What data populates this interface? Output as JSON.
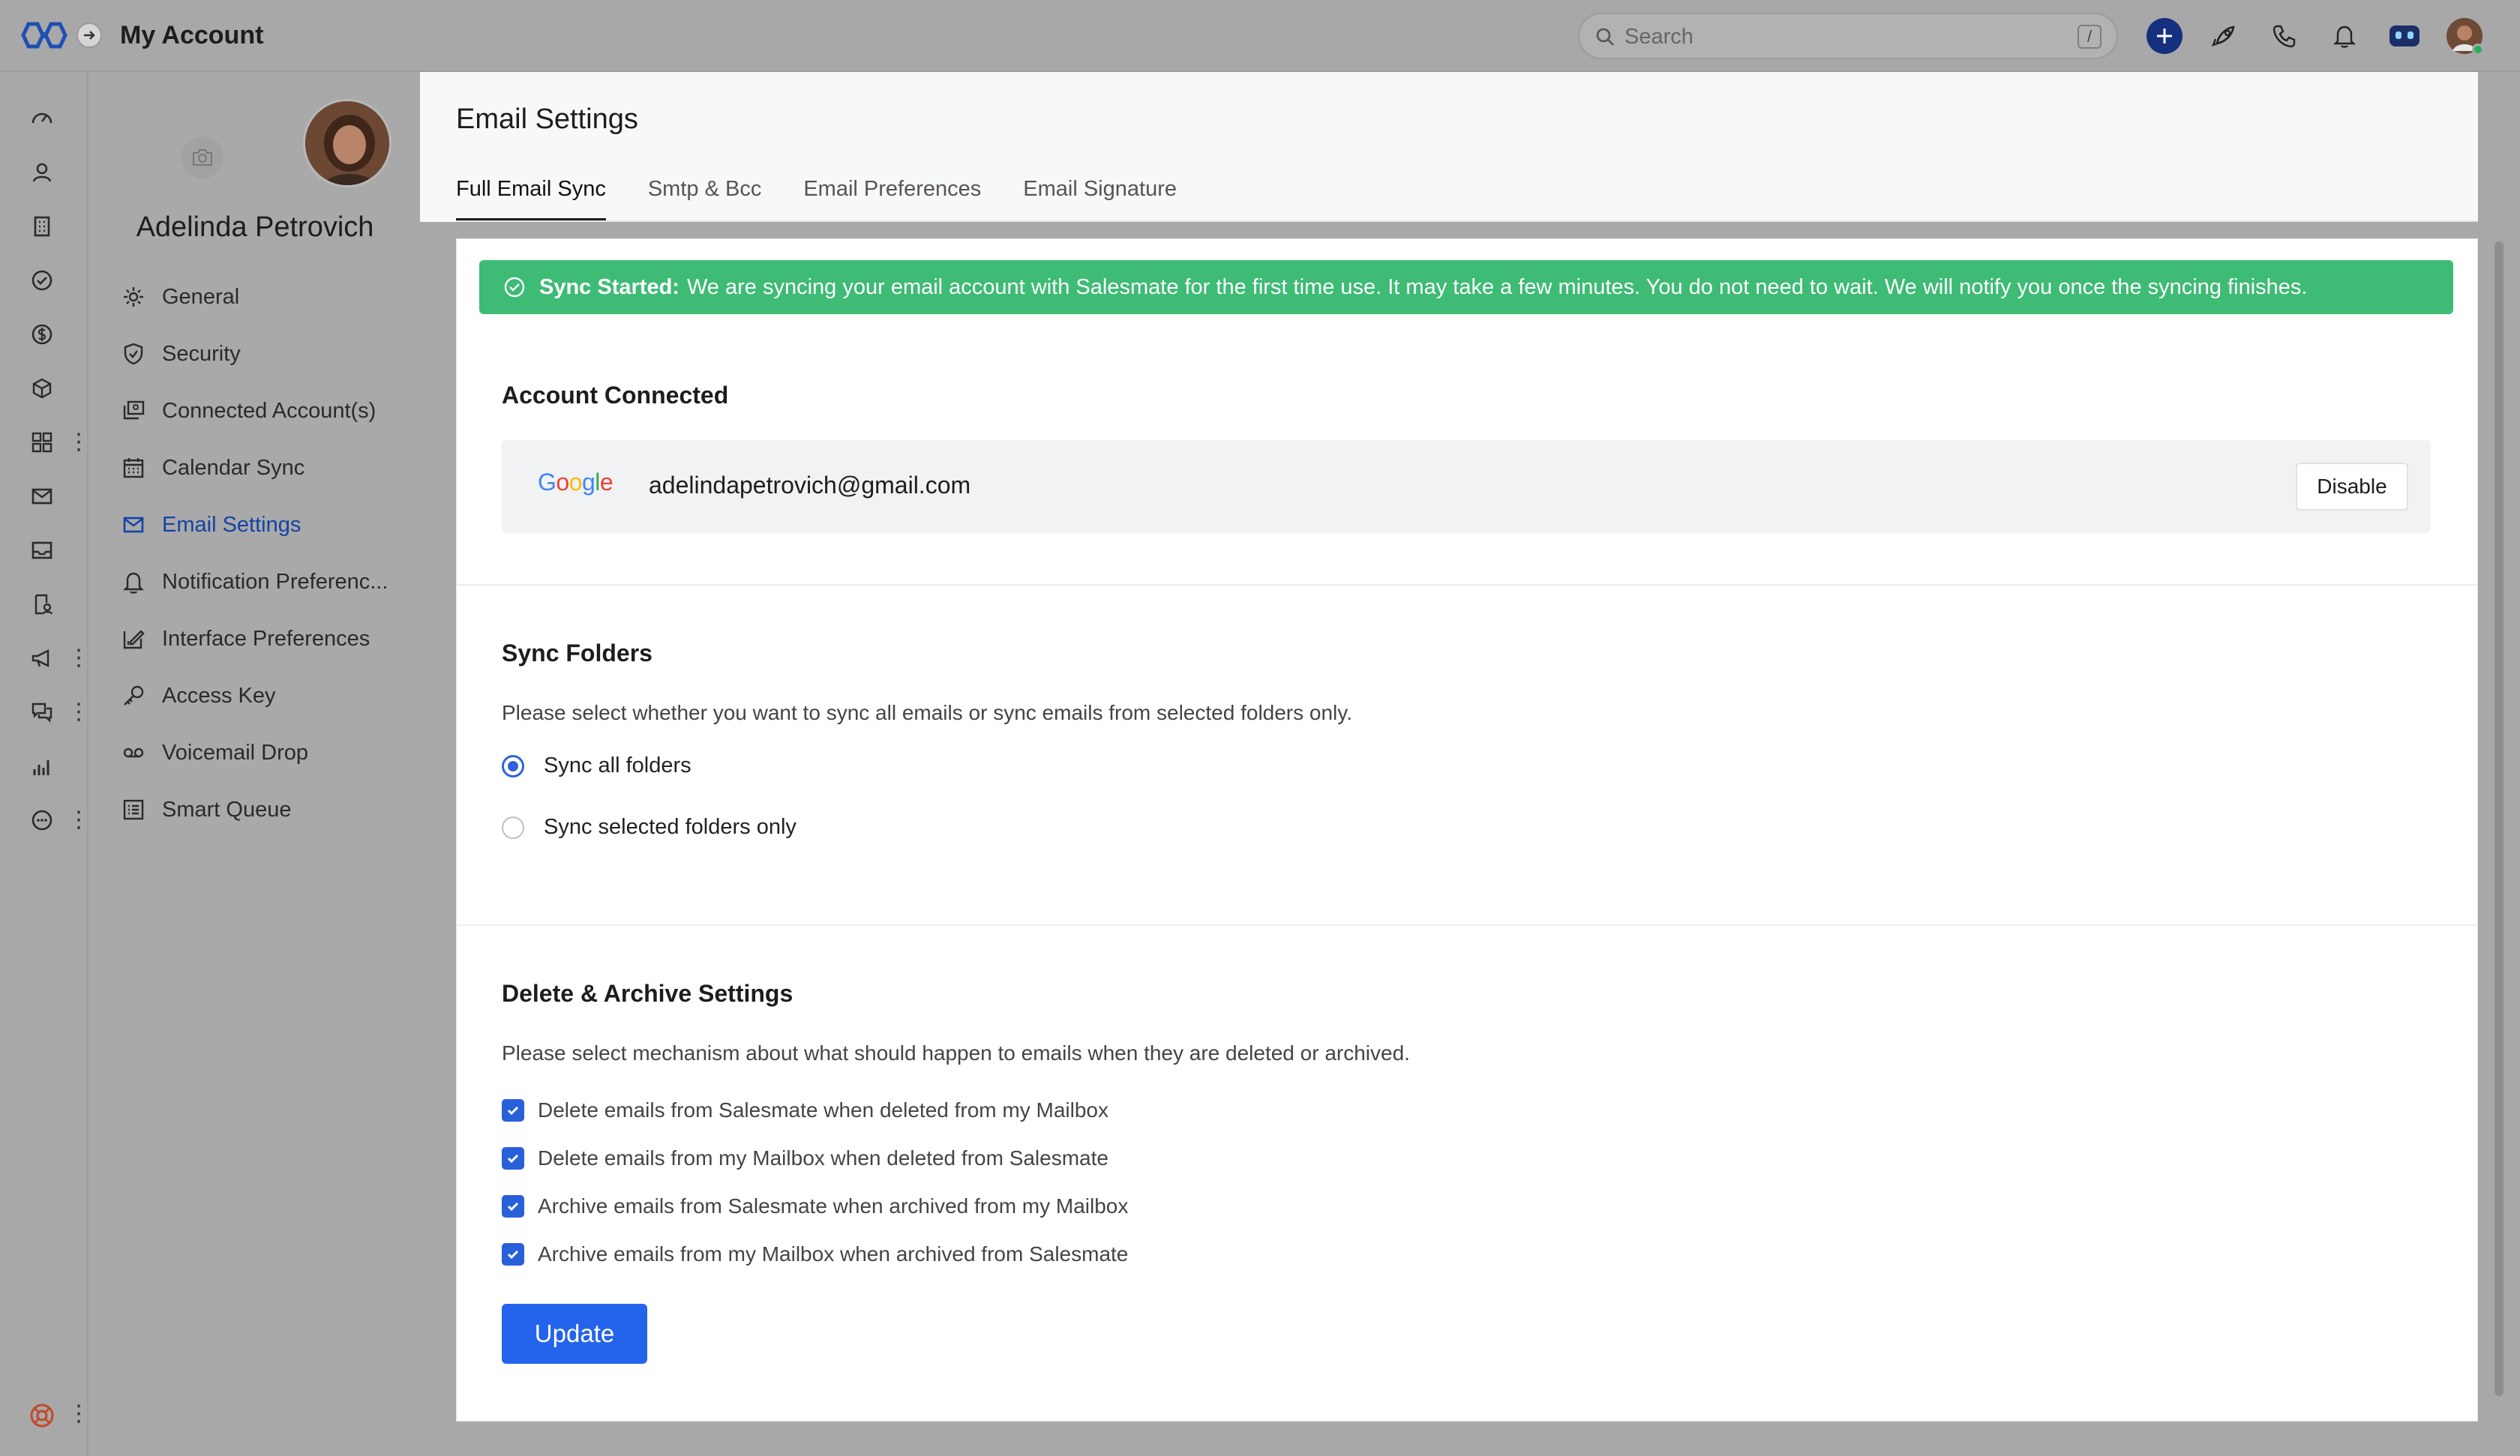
{
  "app": {
    "title": "My Account"
  },
  "search": {
    "placeholder": "Search",
    "shortcut": "/"
  },
  "profile": {
    "name": "Adelinda Petrovich"
  },
  "sidebar": {
    "items": [
      {
        "label": "General",
        "icon": "gear-icon"
      },
      {
        "label": "Security",
        "icon": "shield-icon"
      },
      {
        "label": "Connected Account(s)",
        "icon": "connected-accounts-icon"
      },
      {
        "label": "Calendar Sync",
        "icon": "calendar-icon"
      },
      {
        "label": "Email Settings",
        "icon": "mail-icon"
      },
      {
        "label": "Notification Preferenc...",
        "icon": "bell-icon"
      },
      {
        "label": "Interface Preferences",
        "icon": "interface-icon"
      },
      {
        "label": "Access Key",
        "icon": "key-icon"
      },
      {
        "label": "Voicemail Drop",
        "icon": "voicemail-icon"
      },
      {
        "label": "Smart Queue",
        "icon": "queue-icon"
      }
    ],
    "active_index": 4
  },
  "main": {
    "title": "Email Settings",
    "tabs": [
      {
        "label": "Full Email Sync"
      },
      {
        "label": "Smtp & Bcc"
      },
      {
        "label": "Email Preferences"
      },
      {
        "label": "Email Signature"
      }
    ],
    "active_tab": 0
  },
  "banner": {
    "title": "Sync Started:",
    "message": "We are syncing your email account with Salesmate for the first time use. It may take a few minutes. You do not need to wait. We will notify you once the syncing finishes."
  },
  "account": {
    "section_title": "Account Connected",
    "provider": "Google",
    "email": "adelindapetrovich@gmail.com",
    "disable_label": "Disable"
  },
  "sync_folders": {
    "section_title": "Sync Folders",
    "description": "Please select whether you want to sync all emails or sync emails from selected folders only.",
    "options": [
      {
        "label": "Sync all folders",
        "selected": true
      },
      {
        "label": "Sync selected folders only",
        "selected": false
      }
    ]
  },
  "delete_archive": {
    "section_title": "Delete & Archive Settings",
    "description": "Please select mechanism about what should happen to emails when they are deleted or archived.",
    "options": [
      {
        "label": "Delete emails from Salesmate when deleted from my Mailbox",
        "checked": true
      },
      {
        "label": "Delete emails from my Mailbox when deleted from Salesmate",
        "checked": true
      },
      {
        "label": "Archive emails from Salesmate when archived from my Mailbox",
        "checked": true
      },
      {
        "label": "Archive emails from my Mailbox when archived from Salesmate",
        "checked": true
      }
    ]
  },
  "update_label": "Update",
  "colors": {
    "accent": "#2463eb",
    "banner": "#3ebb74",
    "active_nav": "#1443a6"
  }
}
